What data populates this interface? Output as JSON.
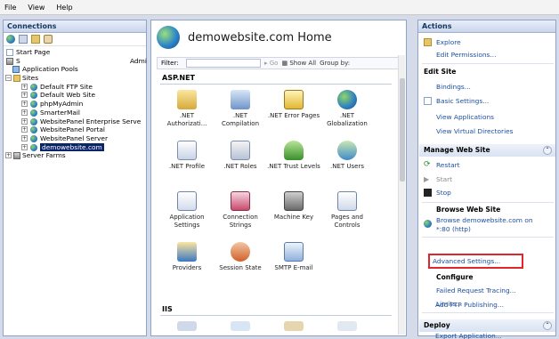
{
  "menu": {
    "file": "File",
    "view": "View",
    "help": "Help"
  },
  "connections": {
    "title": "Connections",
    "tree": [
      {
        "label": "Start Page",
        "icon": "start-page-icon"
      },
      {
        "label": "S",
        "suffix": "Admi",
        "icon": "server-icon"
      },
      {
        "label": "Application Pools",
        "icon": "app-pools-icon"
      },
      {
        "label": "Sites",
        "icon": "folder-icon"
      },
      {
        "label": "Default FTP Site",
        "icon": "globe-icon"
      },
      {
        "label": "Default Web Site",
        "icon": "globe-icon"
      },
      {
        "label": "phpMyAdmin",
        "icon": "globe-icon"
      },
      {
        "label": "SmarterMail",
        "icon": "globe-icon"
      },
      {
        "label": "WebsitePanel Enterprise Serve",
        "icon": "globe-icon"
      },
      {
        "label": "WebsitePanel Portal",
        "icon": "globe-icon"
      },
      {
        "label": "WebsitePanel Server",
        "icon": "globe-icon"
      },
      {
        "label": "demowebsite.com",
        "icon": "globe-icon",
        "selected": true
      },
      {
        "label": "Server Farms",
        "icon": "server-farms-icon"
      }
    ]
  },
  "center": {
    "title": "demowebsite.com Home",
    "filter": {
      "label": "Filter:",
      "go": "Go",
      "show_all": "Show All",
      "group_by": "Group by:"
    },
    "groups": [
      {
        "name": "ASP.NET"
      },
      {
        "name": "IIS"
      }
    ],
    "features": [
      [
        ".NET Authorizati...",
        ".NET Compilation",
        ".NET Error Pages",
        ".NET Globalization"
      ],
      [
        ".NET Profile",
        ".NET Roles",
        ".NET Trust Levels",
        ".NET Users"
      ],
      [
        "Application Settings",
        "Connection Strings",
        "Machine Key",
        "Pages and Controls"
      ],
      [
        "Providers",
        "Session State",
        "SMTP E-mail"
      ]
    ]
  },
  "actions": {
    "title": "Actions",
    "explore": "Explore",
    "edit_permissions": "Edit Permissions...",
    "edit_site": "Edit Site",
    "bindings": "Bindings...",
    "basic_settings": "Basic Settings...",
    "view_applications": "View Applications",
    "view_virtual_dirs": "View Virtual Directories",
    "manage": "Manage Web Site",
    "restart": "Restart",
    "start": "Start",
    "stop": "Stop",
    "browse_head": "Browse Web Site",
    "browse_line1": "Browse demowebsite.com on",
    "browse_line2": "*:80 (http)",
    "advanced_settings": "Advanced Settings...",
    "configure": "Configure",
    "failed_request": "Failed Request Tracing...",
    "limits": "Limits...",
    "add_ftp": "Add FTP Publishing...",
    "deploy": "Deploy",
    "export_app": "Export Application..."
  },
  "colors": {
    "link": "#1f4fa0",
    "highlight": "#e0262d",
    "selection": "#0a246a"
  }
}
